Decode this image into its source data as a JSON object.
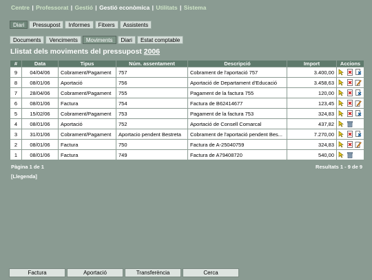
{
  "topnav": {
    "items": [
      "Centre",
      "Professorat",
      "Gestió",
      "Gestió econòmica",
      "Utilitats",
      "Sistema"
    ],
    "separator": "|"
  },
  "main_tabs": [
    "Diari",
    "Pressupost",
    "Informes",
    "Fitxers",
    "Assistents"
  ],
  "sub_tabs": [
    "Documents",
    "Venciments",
    "Moviments",
    "Diari",
    "Estat comptable"
  ],
  "title": {
    "prefix": "Llistat dels moviments del pressupost",
    "year": "2006"
  },
  "table": {
    "headers": [
      "#",
      "Data",
      "Tipus",
      "Núm. assentament",
      "Descripció",
      "Import",
      "Accions"
    ],
    "rows": [
      {
        "num": "9",
        "date": "04/04/06",
        "type": "Cobrament/Pagament",
        "entry": "757",
        "desc": "Cobrament de l'aportació 757",
        "amount": "3.400,00",
        "actions": [
          "edit",
          "delete",
          "cancel"
        ]
      },
      {
        "num": "8",
        "date": "08/01/06",
        "type": "Aportació",
        "entry": "756",
        "desc": "Aportació de Departament d'Educació",
        "amount": "3.458,63",
        "actions": [
          "edit",
          "delete",
          "pay"
        ]
      },
      {
        "num": "7",
        "date": "28/04/06",
        "type": "Cobrament/Pagament",
        "entry": "755",
        "desc": "Pagament de la factura 755",
        "amount": "120,00",
        "actions": [
          "edit",
          "delete",
          "cancel"
        ]
      },
      {
        "num": "6",
        "date": "08/01/06",
        "type": "Factura",
        "entry": "754",
        "desc": "Factura de B62414677",
        "amount": "123,45",
        "actions": [
          "edit",
          "delete",
          "pay"
        ]
      },
      {
        "num": "5",
        "date": "15/02/06",
        "type": "Cobrament/Pagament",
        "entry": "753",
        "desc": "Pagament de la factura 753",
        "amount": "324,83",
        "actions": [
          "edit",
          "delete",
          "cancel"
        ]
      },
      {
        "num": "4",
        "date": "08/01/06",
        "type": "Aportació",
        "entry": "752",
        "desc": "Aportació de Consell Comarcal",
        "amount": "437,82",
        "actions": [
          "edit",
          "trash"
        ]
      },
      {
        "num": "3",
        "date": "31/01/06",
        "type": "Cobrament/Pagament",
        "entry": "Aportacio pendent Bestreta",
        "desc": "Cobrament de l'aportació pendent Bes...",
        "amount": "7.270,00",
        "actions": [
          "edit",
          "delete",
          "cancel"
        ]
      },
      {
        "num": "2",
        "date": "08/01/06",
        "type": "Factura",
        "entry": "750",
        "desc": "Factura de A-25040759",
        "amount": "324,83",
        "actions": [
          "edit",
          "delete",
          "pay"
        ]
      },
      {
        "num": "1",
        "date": "08/01/06",
        "type": "Factura",
        "entry": "749",
        "desc": "Factura de A79408720",
        "amount": "540,00",
        "actions": [
          "edit",
          "trash"
        ]
      }
    ]
  },
  "pagination": "Pàgina 1 de 1",
  "results": "Resultats 1 - 9 de 9",
  "legend": "[Llegenda]",
  "bottom_buttons": [
    "Factura",
    "Aportació",
    "Transferència",
    "Cerca"
  ],
  "colors": {
    "background": "#8a9b92",
    "header": "#5f7a6c",
    "active_tab": "#6f8679",
    "nav_link": "#cfe5c7"
  }
}
